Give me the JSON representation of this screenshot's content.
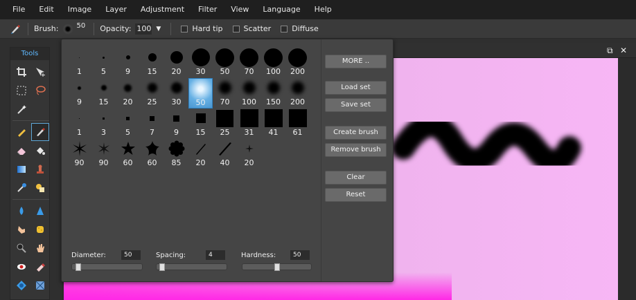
{
  "menu": [
    "File",
    "Edit",
    "Image",
    "Layer",
    "Adjustment",
    "Filter",
    "View",
    "Language",
    "Help"
  ],
  "options": {
    "brush_label": "Brush:",
    "brush_size": "50",
    "opacity_label": "Opacity:",
    "opacity_value": "100",
    "hard_tip_label": "Hard tip",
    "scatter_label": "Scatter",
    "diffuse_label": "Diffuse"
  },
  "tools": {
    "title": "Tools"
  },
  "brushes": {
    "rows": [
      [
        "1",
        "5",
        "9",
        "15",
        "20",
        "30",
        "50",
        "70",
        "100",
        "200"
      ],
      [
        "9",
        "15",
        "20",
        "25",
        "30",
        "50",
        "70",
        "100",
        "150",
        "200"
      ],
      [
        "1",
        "3",
        "5",
        "7",
        "9",
        "15",
        "25",
        "31",
        "41",
        "61"
      ],
      [
        "90",
        "90",
        "60",
        "60",
        "85",
        "20",
        "40",
        "20"
      ]
    ],
    "selected": "50"
  },
  "buttons": {
    "more": "MORE ..",
    "load_set": "Load set",
    "save_set": "Save set",
    "create_brush": "Create brush",
    "remove_brush": "Remove brush",
    "clear": "Clear",
    "reset": "Reset"
  },
  "sliders": {
    "diameter_label": "Diameter:",
    "diameter_value": "50",
    "spacing_label": "Spacing:",
    "spacing_value": "4",
    "hardness_label": "Hardness:",
    "hardness_value": "50",
    "diameter_fraction": 0.05,
    "spacing_fraction": 0.04,
    "hardness_fraction": 0.5
  },
  "colors": {
    "accent": "#5fb9ff",
    "selected_brush": "#66b0e4",
    "canvas_pink": "#f7b6f5",
    "canvas_magenta": "#ff4fe0"
  }
}
